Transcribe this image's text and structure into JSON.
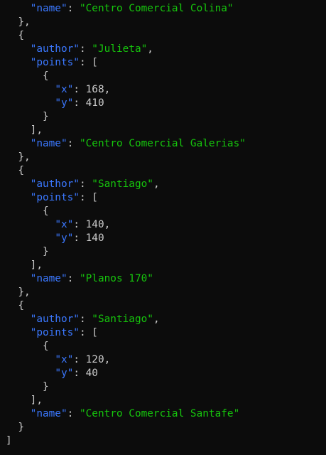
{
  "console": {
    "tokens": {
      "brace_close_comma": "},",
      "brace_open": "{",
      "brace_close": "}",
      "bracket_open": "[",
      "bracket_close_comma": "],",
      "bracket_close": "]",
      "colon": ": ",
      "comma": ","
    },
    "key_name": "\"name\"",
    "key_author": "\"author\"",
    "key_points": "\"points\"",
    "key_x": "\"x\"",
    "key_y": "\"y\"",
    "entries": [
      {
        "name": "\"Centro Comercial Colina\""
      },
      {
        "author": "\"Julieta\"",
        "x": "168",
        "y": "410",
        "name": "\"Centro Comercial Galerias\""
      },
      {
        "author": "\"Santiago\"",
        "x": "140",
        "y": "140",
        "name": "\"Planos 170\""
      },
      {
        "author": "\"Santiago\"",
        "x": "120",
        "y": "40",
        "name": "\"Centro Comercial Santafe\""
      }
    ]
  }
}
